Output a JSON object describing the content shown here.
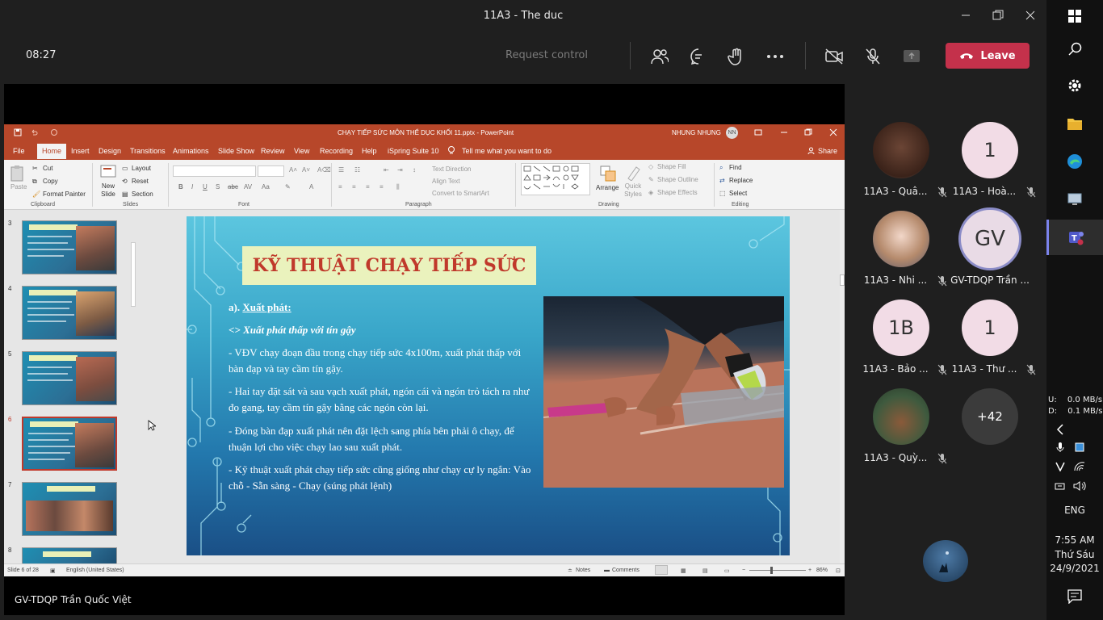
{
  "window": {
    "title": "11A3 - The duc"
  },
  "call": {
    "timer": "08:27",
    "request_control": "Request control",
    "leave": "Leave"
  },
  "sharer": "GV-TDQP Trần Quốc Việt",
  "ppt": {
    "title": "CHẠY TIẾP SỨC MÔN THỂ DỤC KHỐI 11.pptx - PowerPoint",
    "user": "NHUNG NHUNG",
    "initials": "NN",
    "menu": [
      "File",
      "Home",
      "Insert",
      "Design",
      "Transitions",
      "Animations",
      "Slide Show",
      "Review",
      "View",
      "Recording",
      "Help",
      "iSpring Suite 10"
    ],
    "tell_me": "Tell me what you want to do",
    "share": "Share",
    "clipboard": {
      "paste": "Paste",
      "cut": "Cut",
      "copy": "Copy",
      "format_painter": "Format Painter",
      "label": "Clipboard"
    },
    "slides_group": {
      "new_slide": "New Slide",
      "layout": "Layout",
      "reset": "Reset",
      "section": "Section",
      "label": "Slides"
    },
    "font_label": "Font",
    "paragraph": {
      "text_direction": "Text Direction",
      "align_text": "Align Text",
      "convert_smartart": "Convert to SmartArt",
      "label": "Paragraph"
    },
    "drawing": {
      "arrange": "Arrange",
      "quick_styles": "Quick Styles",
      "shape_fill": "Shape Fill",
      "shape_outline": "Shape Outline",
      "shape_effects": "Shape Effects",
      "label": "Drawing"
    },
    "editing": {
      "find": "Find",
      "replace": "Replace",
      "select": "Select",
      "label": "Editing"
    },
    "thumbnails": [
      {
        "num": "3",
        "title": "KỸ THUẬT CHẠY TIẾP SỨC"
      },
      {
        "num": "4",
        "title": "KỸ THUẬT CHẠY TIẾP SỨC"
      },
      {
        "num": "5",
        "title": "KỸ THUẬT CHẠY TIẾP SỨC"
      },
      {
        "num": "6",
        "title": "KỸ THUẬT CHẠY TIẾP SỨC"
      },
      {
        "num": "7",
        "title": "KỸ THUẬT CHẠY TIẾP SỨC"
      },
      {
        "num": "8",
        "title": "SƠ ĐỒ ĐƯỜNG CHẠY TIẾP SỨC"
      }
    ],
    "slide": {
      "title": "KỸ THUẬT CHẠY TIẾP SỨC",
      "h1_prefix": "a). ",
      "h1": "Xuất phát:",
      "h2": "<> Xuất phát thấp với tín gậy",
      "b1": "- VĐV chạy đoạn đầu trong chạy tiếp sức 4x100m, xuất phát thấp với bàn đạp và tay cầm tín gậy.",
      "b2": "- Hai tay đặt sát và sau vạch xuất phát, ngón cái và ngón trỏ tách ra như đo gang, tay cầm tín gậy bằng các ngón còn lại.",
      "b3": "- Đóng bàn đạp xuất phát nên đặt lệch sang phía bên phải ô chạy, để thuận lợi cho việc chạy lao sau xuất phát.",
      "b4": "- Kỹ thuật xuất phát chạy tiếp sức cũng giống như chạy cự ly ngắn: Vào chỗ - Sẵn sàng - Chạy (súng phát lệnh)"
    },
    "status": {
      "slide_of": "Slide 6 of 28",
      "language": "English (United States)",
      "notes": "Notes",
      "comments": "Comments",
      "zoom": "86%"
    }
  },
  "participants": [
    {
      "name": "11A3 - Quâ...",
      "initial": "",
      "bg": "#5a3b2e"
    },
    {
      "name": "11A3 - Hoà...",
      "initial": "1",
      "bg": "#f2dce6"
    },
    {
      "name": "11A3 - Nhi ...",
      "initial": "",
      "bg": "#8a8aa0"
    },
    {
      "name": "GV-TDQP Trần ...",
      "initial": "GV",
      "bg": "#e9dbe6"
    },
    {
      "name": "11A3 - Bảo ...",
      "initial": "1B",
      "bg": "#f2dce6"
    },
    {
      "name": "11A3 - Thư ...",
      "initial": "1",
      "bg": "#f2dce6"
    },
    {
      "name": "11A3 - Quỳ...",
      "initial": "",
      "bg": "#3e5a3e"
    }
  ],
  "more_count": "+42",
  "taskbar": {
    "net_up_label": "U:",
    "net_up": "0.0 MB/s",
    "net_down_label": "D:",
    "net_down": "0.1 MB/s",
    "lang": "ENG",
    "time": "7:55 AM",
    "day": "Thứ Sáu",
    "date": "24/9/2021"
  }
}
